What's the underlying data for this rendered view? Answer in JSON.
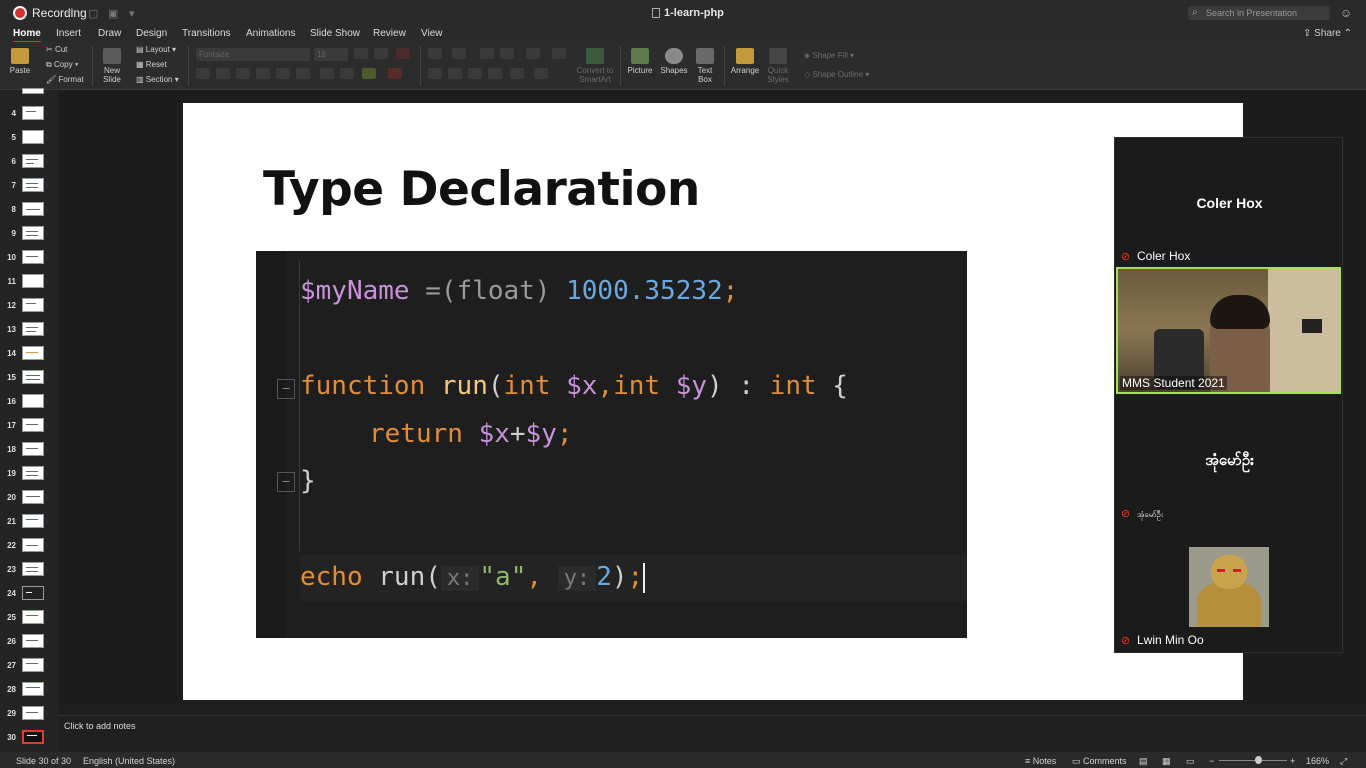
{
  "titlebar": {
    "recording_label": "Recording",
    "document_title": "1-learn-php",
    "search_placeholder": "Search in Presentation"
  },
  "tabs": [
    "Home",
    "Insert",
    "Draw",
    "Design",
    "Transitions",
    "Animations",
    "Slide Show",
    "Review",
    "View"
  ],
  "share_label": "Share",
  "ribbon": {
    "paste": "Paste",
    "cut": "Cut",
    "copy": "Copy",
    "format": "Format",
    "new_slide_1": "New",
    "new_slide_2": "Slide",
    "layout": "Layout",
    "reset": "Reset",
    "section": "Section",
    "font_name": "Fontsize",
    "font_size": "18",
    "convert_1": "Convert to",
    "convert_2": "SmartArt",
    "picture": "Picture",
    "shapes": "Shapes",
    "textbox_1": "Text",
    "textbox_2": "Box",
    "arrange": "Arrange",
    "quick_1": "Quick",
    "quick_2": "Styles",
    "shape_fill": "Shape Fill",
    "shape_outline": "Shape Outline"
  },
  "thumbnails": [
    "4",
    "5",
    "6",
    "7",
    "8",
    "9",
    "10",
    "11",
    "12",
    "13",
    "14",
    "15",
    "16",
    "17",
    "18",
    "19",
    "20",
    "21",
    "22",
    "23",
    "24",
    "25",
    "26",
    "27",
    "28",
    "29",
    "30"
  ],
  "slide": {
    "title": "Type Declaration",
    "code": {
      "line1_var": "$myName",
      "line1_op": " =(float) ",
      "line1_num": "1000.35232",
      "line1_end": ";",
      "line2_kw": "function ",
      "line2_fn": "run",
      "line2_rest_a": "(",
      "line2_int1": "int ",
      "line2_x": "$x",
      "line2_comma": ",",
      "line2_int2": "int ",
      "line2_y": "$y",
      "line2_close": ") : ",
      "line2_int3": "int",
      "line2_brace": " {",
      "line3_kw": "return ",
      "line3_x": "$x",
      "line3_plus": "+",
      "line3_y": "$y",
      "line3_end": ";",
      "line4": "}",
      "line5_kw": "echo ",
      "line5_fn": "run(",
      "line5_hint_x": "x:",
      "line5_str": "\"a\"",
      "line5_comma": ", ",
      "line5_hint_y": "y:",
      "line5_num": "2",
      "line5_close": ")",
      "line5_end": ";"
    }
  },
  "zoom": {
    "speaker_big": "Coler Hox",
    "speaker_label": "Coler Hox",
    "video_caption": "MMS Student 2021",
    "participant2_big": "အုံမော်ဦး",
    "participant2_label": "အုံမော်ဦး",
    "participant3_label": "Lwin Min Oo"
  },
  "notes_placeholder": "Click to add notes",
  "status": {
    "slide_counter": "Slide 30 of 30",
    "language": "English (United States)",
    "notes": "Notes",
    "comments": "Comments",
    "zoom_level": "166%"
  },
  "colors": {
    "accent": "#d2332c",
    "active_speaker_border": "#a4e05a"
  }
}
